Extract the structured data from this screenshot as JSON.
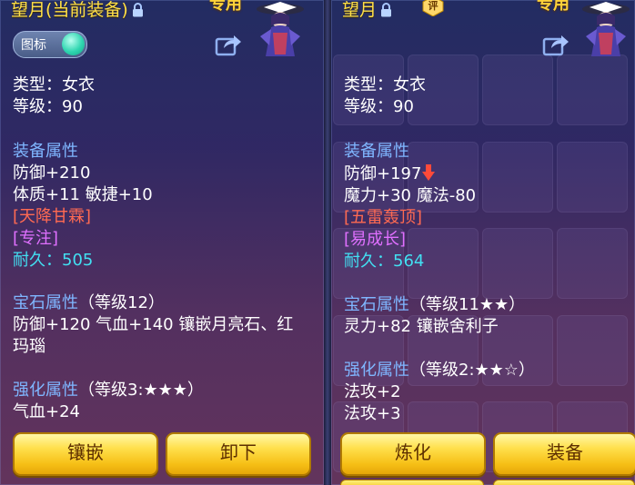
{
  "left": {
    "name": "望月",
    "name_suffix": "(当前装备)",
    "special_label": "专用",
    "toggle_label": "图标",
    "type_line": "类型：女衣",
    "level_line": "等级：90",
    "equip_attr_title": "装备属性",
    "attr_line_1": "防御+210",
    "attr_line_2": "体质+11 敏捷+10",
    "special_effect": "[天降甘霖]",
    "special_skill": "[专注]",
    "durability_label": "耐久：",
    "durability_value": "505",
    "gem_title": "宝石属性",
    "gem_level": "（等级12）",
    "gem_line_1": "防御+120 气血+140 镶嵌月亮石、红",
    "gem_line_2": "玛瑙",
    "strengthen_title": "强化属性",
    "strengthen_level": "（等级3:★★★）",
    "strengthen_line_1": "气血+24",
    "button_1": "镶嵌",
    "button_2": "卸下"
  },
  "right": {
    "name": "望月",
    "eval_badge": "评",
    "special_label": "专用",
    "type_line": "类型：女衣",
    "level_line": "等级：90",
    "equip_attr_title": "装备属性",
    "attr_line_1": "防御+197",
    "attr_line_2": "魔力+30 魔法-80",
    "special_effect": "[五雷轰顶]",
    "special_skill": "[易成长]",
    "durability_label": "耐久：",
    "durability_value": "564",
    "gem_title": "宝石属性",
    "gem_level": "（等级11★★）",
    "gem_line_1": "灵力+82 镶嵌舍利子",
    "strengthen_title": "强化属性",
    "strengthen_level": "（等级2:★★☆）",
    "strengthen_line_1": "法攻+2",
    "strengthen_line_2": "法攻+3",
    "button_1": "炼化",
    "button_2": "装备"
  },
  "colors": {
    "name_gold": "#ffe04a",
    "attr_title_blue": "#7fb6ff",
    "effect_red": "#ff6a52",
    "skill_purple": "#e070ff",
    "durability_cyan": "#42e0f2",
    "button_gold": "#ffe04c"
  },
  "icons": [
    "lock-icon",
    "character-portrait-icon",
    "share-icon",
    "down-arrow-icon",
    "eval-badge-icon"
  ]
}
